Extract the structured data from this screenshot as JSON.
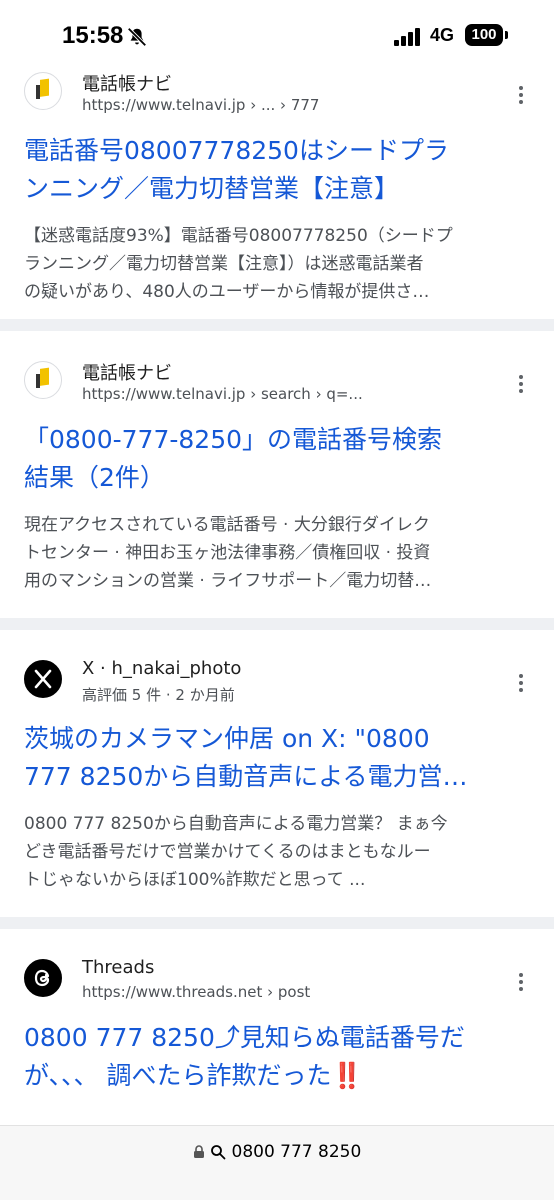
{
  "status": {
    "time": "15:58",
    "network": "4G",
    "battery": "100"
  },
  "results": [
    {
      "site_name": "電話帳ナビ",
      "url": "https://www.telnavi.jp › ... › 777",
      "title_lines": [
        "電話番号08007778250はシードプラ",
        "ンニング／電力切替営業【注意】"
      ],
      "snippet_lines": [
        "【迷惑電話度93%】電話番号08007778250（シードプ",
        "ランニング／電力切替営業【注意】）は迷惑電話業者",
        "の疑いがあり、480人のユーザーから情報が提供さ…"
      ]
    },
    {
      "site_name": "電話帳ナビ",
      "url": "https://www.telnavi.jp › search › q=...",
      "title_lines": [
        "「0800-777-8250」の電話番号検索",
        "結果（2件）"
      ],
      "snippet_lines": [
        "現在アクセスされている電話番号 · 大分銀行ダイレク",
        "トセンター · 神田お玉ヶ池法律事務／債権回収 · 投資",
        "用のマンションの営業 · ライフサポート／電力切替…"
      ]
    },
    {
      "site_name": "X · h_nakai_photo",
      "url": "高評価 5 件 · 2 か月前",
      "title_lines": [
        "茨城のカメラマン仲居 on X: \"0800",
        "777 8250から自動音声による電力営…"
      ],
      "snippet_lines": [
        "0800 777 8250から自動音声による電力営業？ まぁ今",
        "どき電話番号だけで営業かけてくるのはまともなルー",
        "トじゃないからほぼ100%詐欺だと思って ..."
      ]
    },
    {
      "site_name": "Threads",
      "url": "https://www.threads.net › post",
      "title_lines": [
        "0800 777 8250⤴見知らぬ電話番号だ",
        "が、、、 調べたら詐欺だった‼️"
      ],
      "snippet_lines": []
    }
  ],
  "address_bar": {
    "query": "0800 777 8250"
  },
  "colors": {
    "link": "#1558d6",
    "divider": "#eef0f3",
    "snippet": "#4d5156"
  },
  "icons": [
    "bell-slash-icon",
    "telnavi-favicon",
    "x-favicon",
    "threads-favicon",
    "more-vert-icon",
    "lock-icon",
    "search-icon"
  ]
}
